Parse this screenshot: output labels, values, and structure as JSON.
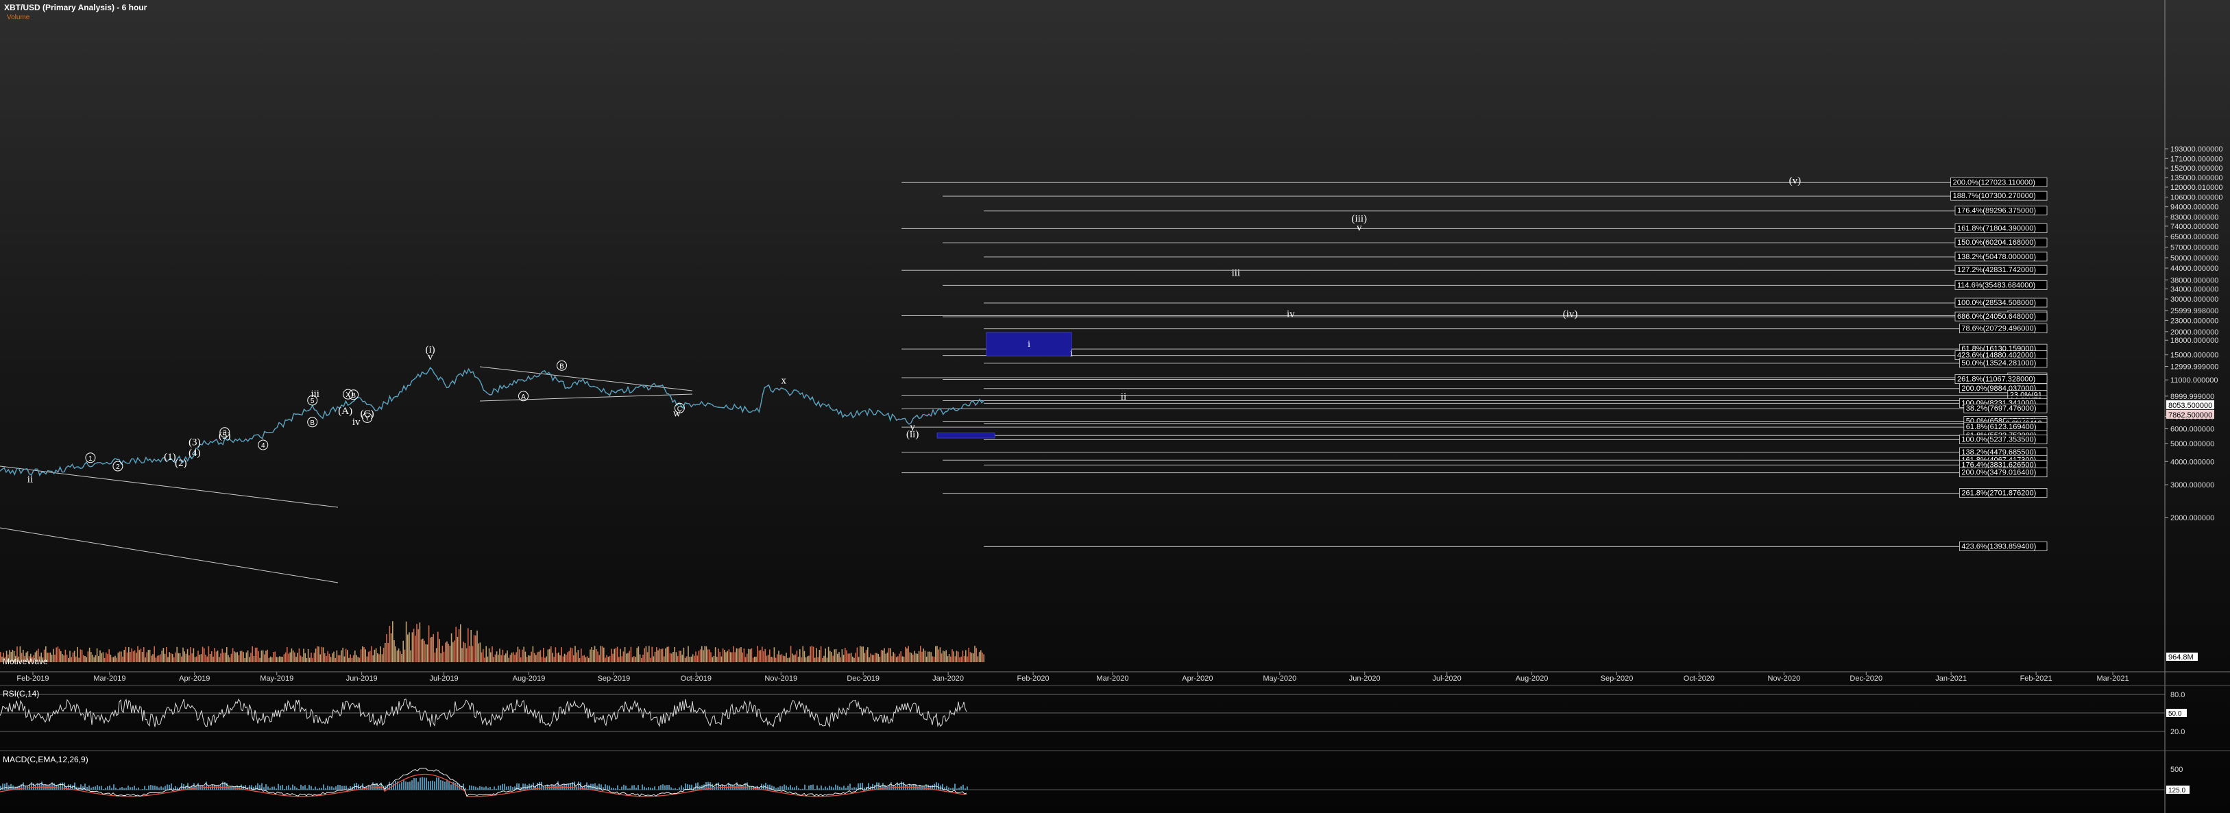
{
  "header": {
    "title": "XBT/USD (Primary Analysis) - 6 hour",
    "subtitle": "Volume",
    "watermark": "MotiveWave"
  },
  "panels": {
    "rsi_label": "RSI(C,14)",
    "macd_label": "MACD(C,EMA,12,26,9)",
    "rsi_ticks": [
      "80.0",
      "50.0",
      "20.0"
    ],
    "macd_ticks": [
      "500",
      "125.0"
    ],
    "rsi_current": "50.0",
    "macd_current": "125.0"
  },
  "colors": {
    "up": "#3cb9e0",
    "down": "#e0504a",
    "volume": "#d8684a",
    "target_box": "#1a1a9a"
  },
  "chart_data": {
    "type": "line",
    "title": "XBT/USD (Primary Analysis) - 6 hour",
    "x_tick_labels": [
      "Feb-2019",
      "Mar-2019",
      "Apr-2019",
      "May-2019",
      "Jun-2019",
      "Jul-2019",
      "Aug-2019",
      "Sep-2019",
      "Oct-2019",
      "Nov-2019",
      "Dec-2019",
      "Jan-2020",
      "Feb-2020",
      "Mar-2020",
      "Apr-2020",
      "May-2020",
      "Jun-2020",
      "Jul-2020",
      "Aug-2020",
      "Sep-2020",
      "Oct-2020",
      "Nov-2020",
      "Dec-2020",
      "Jan-2021",
      "Feb-2021",
      "Mar-2021"
    ],
    "y_scale": "log",
    "y_tick_labels": [
      "193000.000000",
      "171000.000000",
      "152000.000000",
      "135000.000000",
      "120000.010000",
      "106000.000000",
      "94000.000000",
      "83000.000000",
      "74000.000000",
      "65000.000000",
      "57000.000000",
      "50000.000000",
      "44000.000000",
      "38000.000000",
      "34000.000000",
      "30000.000000",
      "25999.998000",
      "23000.000000",
      "20000.000000",
      "18000.000000",
      "15000.000000",
      "12999.999000",
      "11000.000000",
      "8999.999000",
      "7000.000000",
      "6000.000000",
      "5000.000000",
      "4000.000000",
      "3000.000000",
      "2000.000000"
    ],
    "last_price_label": "8053.500000",
    "last_price_label_2": "7862.500000",
    "volume_label": "964.8M",
    "price_series": {
      "name": "XBT/USD",
      "x": [
        "2019-01-20",
        "2019-02-05",
        "2019-02-25",
        "2019-03-15",
        "2019-03-31",
        "2019-04-03",
        "2019-04-25",
        "2019-05-14",
        "2019-05-17",
        "2019-05-30",
        "2019-06-06",
        "2019-06-26",
        "2019-07-02",
        "2019-07-10",
        "2019-07-17",
        "2019-08-06",
        "2019-08-15",
        "2019-08-20",
        "2019-08-29",
        "2019-09-18",
        "2019-09-24",
        "2019-10-06",
        "2019-10-24",
        "2019-10-26",
        "2019-11-08",
        "2019-11-25",
        "2019-12-04",
        "2019-12-17",
        "2019-12-25",
        "2020-01-08",
        "2020-01-14"
      ],
      "values": [
        3550,
        3500,
        3950,
        4050,
        4150,
        4950,
        5400,
        8000,
        7000,
        8800,
        7500,
        12800,
        10000,
        12600,
        9300,
        12200,
        10000,
        10800,
        9400,
        10200,
        8000,
        8200,
        7400,
        10000,
        9200,
        7000,
        7500,
        6500,
        7200,
        8000,
        8500
      ]
    },
    "fib_levels": [
      {
        "label": "200.0%(127023.110000)",
        "value": 127023.11
      },
      {
        "label": "188.7%(107300.270000)",
        "value": 107300.27
      },
      {
        "label": "176.4%(89296.375000)",
        "value": 89296.375
      },
      {
        "label": "161.8%(71804.390000)",
        "value": 71804.39
      },
      {
        "label": "150.0%(60204.168000)",
        "value": 60204.168
      },
      {
        "label": "138.2%(50478.000000)",
        "value": 50478.0
      },
      {
        "label": "127.2%(42831.742000)",
        "value": 42831.742
      },
      {
        "label": "114.6%(35483.684000)",
        "value": 35483.684
      },
      {
        "label": "100.0%(28534.508000)",
        "value": 28534.508
      },
      {
        "label": "88.7%(24",
        "value": 24400
      },
      {
        "label": "686.0%(24050.648000)",
        "value": 24050.648
      },
      {
        "label": "78.6%(20729.496000)",
        "value": 20729.496
      },
      {
        "label": "61.8%(16130.159000)",
        "value": 16130.159
      },
      {
        "label": "423.6%(14880.402000)",
        "value": 14880.402
      },
      {
        "label": "50.0%(13524.281000)",
        "value": 13524.281
      },
      {
        "label": "38.2%(11",
        "value": 11300
      },
      {
        "label": "261.8%(11067.328000)",
        "value": 11067.328
      },
      {
        "label": "200.0%(9884.037000)",
        "value": 9884.037
      },
      {
        "label": "23.0%(91",
        "value": 9100
      },
      {
        "label": "14.6%(79",
        "value": 8500
      },
      {
        "label": "100.0%(8231.341000)",
        "value": 8231.341
      },
      {
        "label": "38.2%(7697.476000)",
        "value": 7697.476
      },
      {
        "label": "50.0%(6588.076000)",
        "value": 6588.076
      },
      {
        "label": "0.0%(6410",
        "value": 6410
      },
      {
        "label": "61.8%(6123.169400)",
        "value": 6123.1694
      },
      {
        "label": "61.8%(5523.752000)",
        "value": 5523.752
      },
      {
        "label": "100.0%(5237.353500)",
        "value": 5237.3535
      },
      {
        "label": "138.2%(4479.685500)",
        "value": 4479.6855
      },
      {
        "label": "161.8%(4067.417300)",
        "value": 4067.4173
      },
      {
        "label": "176.4%(3831.626500)",
        "value": 3831.6265
      },
      {
        "label": "200.0%(3479.016400)",
        "value": 3479.0164
      },
      {
        "label": "261.8%(2701.876200)",
        "value": 2701.8762
      },
      {
        "label": "423.6%(1393.859400)",
        "value": 1393.8594
      }
    ],
    "wave_labels": [
      {
        "text": "(v)",
        "date": "2020-11-05",
        "value": 125000
      },
      {
        "text": "(iii)",
        "date": "2020-05-30",
        "value": 78000
      },
      {
        "text": "v",
        "date": "2020-05-30",
        "value": 70000
      },
      {
        "text": "iii",
        "date": "2020-04-15",
        "value": 40000
      },
      {
        "text": "iv",
        "date": "2020-05-05",
        "value": 24000
      },
      {
        "text": "(iv)",
        "date": "2020-08-15",
        "value": 24000
      },
      {
        "text": "i",
        "date": "2020-02-15",
        "value": 14800
      },
      {
        "text": "ii",
        "date": "2020-03-05",
        "value": 8600
      },
      {
        "text": "x",
        "date": "2019-11-02",
        "value": 10500
      },
      {
        "text": "w",
        "date": "2019-09-24",
        "value": 7000
      },
      {
        "text": "y",
        "date": "2019-12-19",
        "value": 5900
      },
      {
        "text": "(ii)",
        "date": "2019-12-19",
        "value": 5400
      },
      {
        "text": "(i)",
        "date": "2019-06-26",
        "value": 15400
      },
      {
        "text": "v",
        "date": "2019-06-26",
        "value": 14100
      },
      {
        "text": "iii",
        "date": "2019-05-15",
        "value": 8900
      },
      {
        "text": "iv",
        "date": "2019-05-30",
        "value": 6300
      },
      {
        "text": "ii",
        "date": "2019-01-31",
        "value": 3100
      },
      {
        "text": "1",
        "date": "2019-02-22",
        "value": 4050
      },
      {
        "text": "2",
        "date": "2019-03-04",
        "value": 3650
      },
      {
        "text": "(1)",
        "date": "2019-03-23",
        "value": 4080
      },
      {
        "text": "(2)",
        "date": "2019-03-27",
        "value": 3780
      },
      {
        "text": "(3)",
        "date": "2019-04-01",
        "value": 4900
      },
      {
        "text": "(4)",
        "date": "2019-04-01",
        "value": 4300
      },
      {
        "text": "3",
        "date": "2019-04-12",
        "value": 5550
      },
      {
        "text": "(5)",
        "date": "2019-04-12",
        "value": 5300
      },
      {
        "text": "4",
        "date": "2019-04-26",
        "value": 4750
      },
      {
        "text": "5",
        "date": "2019-05-14",
        "value": 8250
      },
      {
        "text": "B",
        "date": "2019-05-14",
        "value": 6300
      },
      {
        "text": "X",
        "date": "2019-05-27",
        "value": 8900
      },
      {
        "text": "B",
        "date": "2019-05-29",
        "value": 8850
      },
      {
        "text": "(A)",
        "date": "2019-05-26",
        "value": 7200
      },
      {
        "text": "(C)",
        "date": "2019-06-03",
        "value": 6950
      },
      {
        "text": "Y",
        "date": "2019-06-03",
        "value": 6650
      },
      {
        "text": "B",
        "date": "2019-08-13",
        "value": 12700
      },
      {
        "text": "A",
        "date": "2019-07-30",
        "value": 8700
      },
      {
        "text": "C",
        "date": "2019-09-25",
        "value": 7500
      }
    ],
    "target_box": {
      "from": "2020-01-15",
      "to": "2020-02-15",
      "low": 14800,
      "high": 19800,
      "label": "i"
    },
    "target_box_2": {
      "from": "2019-12-28",
      "to": "2020-01-18",
      "low": 5350,
      "high": 5700
    }
  }
}
